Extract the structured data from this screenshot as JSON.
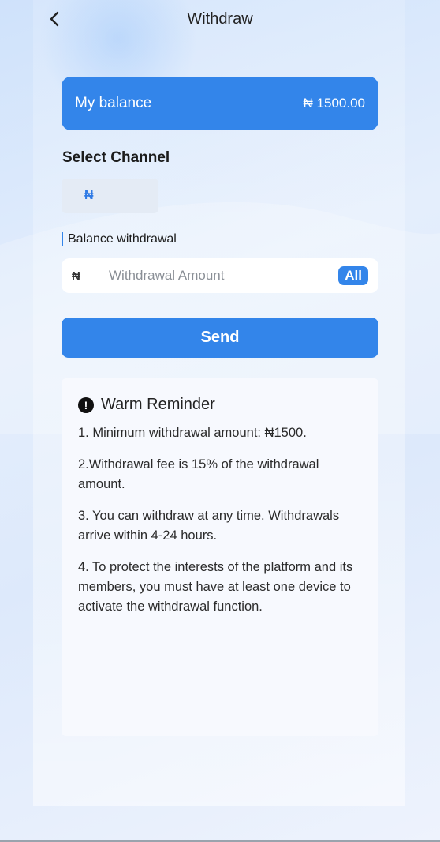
{
  "header": {
    "title": "Withdraw",
    "back_icon": "chevron-left-icon"
  },
  "balance": {
    "label": "My balance",
    "value": "₦ 1500.00"
  },
  "channel": {
    "section_title": "Select Channel",
    "selected": "₦"
  },
  "withdrawal": {
    "section_title": "Balance withdrawal",
    "currency": "₦",
    "placeholder": "Withdrawal Amount",
    "all_label": "All"
  },
  "send_label": "Send",
  "reminder": {
    "icon": "exclamation-icon",
    "title": "Warm Reminder",
    "items": [
      "1. Minimum withdrawal amount: ₦1500.",
      "2.Withdrawal fee is 15% of the withdrawal amount.",
      "3. You can withdraw at any time. Withdrawals arrive within 4-24 hours.",
      "4. To protect the interests of the platform and its members, you must have at least one device to activate the withdrawal function."
    ]
  },
  "colors": {
    "accent": "#3385ea",
    "background": "#dde9fb",
    "card": "#f7f9fe"
  }
}
